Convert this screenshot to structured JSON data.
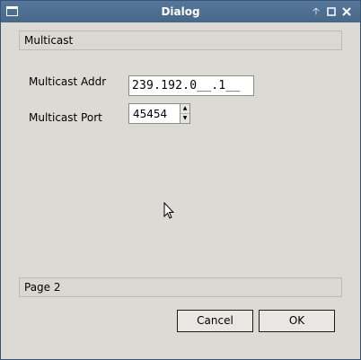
{
  "window": {
    "title": "Dialog",
    "icons": {
      "menu": "window-menu-icon",
      "keep_above": "arrow-up-icon",
      "maximize": "maximize-icon",
      "close": "close-icon"
    }
  },
  "header_section": {
    "label": "Multicast"
  },
  "fields": {
    "addr": {
      "label": "Multicast Addr",
      "value": "239.192.0__.1__"
    },
    "port": {
      "label": "Multicast Port",
      "value": "45454"
    }
  },
  "footer_section": {
    "label": "Page 2"
  },
  "buttons": {
    "cancel": {
      "label": "Cancel"
    },
    "ok": {
      "label": "OK"
    }
  },
  "colors": {
    "titlebar": "#4f6f92",
    "background": "#dcdad5"
  }
}
